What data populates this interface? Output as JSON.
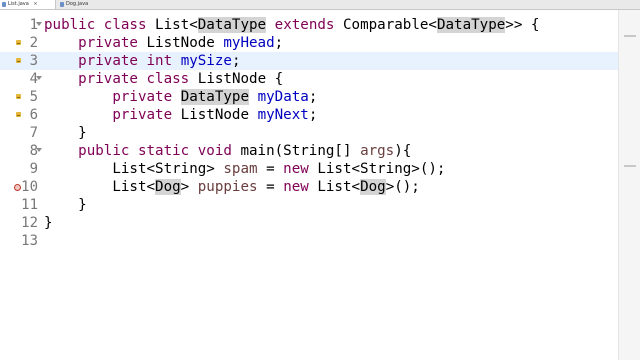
{
  "tabs": [
    {
      "label": "List.java",
      "close": "⨯",
      "active": true
    },
    {
      "label": "Dog.java",
      "close": "",
      "active": false
    }
  ],
  "editor": {
    "lines": [
      {
        "number": "1",
        "marker": "",
        "collapse": true,
        "segments": [
          {
            "t": "public",
            "c": "kw"
          },
          {
            "t": " ",
            "c": ""
          },
          {
            "t": "class",
            "c": "kw"
          },
          {
            "t": " List<",
            "c": ""
          },
          {
            "t": "DataType",
            "c": "hl"
          },
          {
            "t": " ",
            "c": ""
          },
          {
            "t": "extends",
            "c": "kw"
          },
          {
            "t": " Comparable<",
            "c": ""
          },
          {
            "t": "DataType",
            "c": "hl"
          },
          {
            "t": ">> {",
            "c": ""
          }
        ]
      },
      {
        "number": "2",
        "marker": "warning",
        "collapse": false,
        "segments": [
          {
            "t": "    ",
            "c": ""
          },
          {
            "t": "private",
            "c": "kw"
          },
          {
            "t": " ListNode ",
            "c": ""
          },
          {
            "t": "myHead",
            "c": "fld"
          },
          {
            "t": ";",
            "c": ""
          }
        ]
      },
      {
        "number": "3",
        "marker": "warning",
        "collapse": false,
        "current": true,
        "segments": [
          {
            "t": "    ",
            "c": ""
          },
          {
            "t": "private",
            "c": "kw"
          },
          {
            "t": " ",
            "c": ""
          },
          {
            "t": "int",
            "c": "kw"
          },
          {
            "t": " ",
            "c": ""
          },
          {
            "t": "mySize",
            "c": "fld"
          },
          {
            "t": ";",
            "c": ""
          }
        ]
      },
      {
        "number": "4",
        "marker": "",
        "collapse": true,
        "segments": [
          {
            "t": "    ",
            "c": ""
          },
          {
            "t": "private",
            "c": "kw"
          },
          {
            "t": " ",
            "c": ""
          },
          {
            "t": "class",
            "c": "kw"
          },
          {
            "t": " ListNode {",
            "c": ""
          }
        ]
      },
      {
        "number": "5",
        "marker": "warning",
        "collapse": false,
        "segments": [
          {
            "t": "        ",
            "c": ""
          },
          {
            "t": "private",
            "c": "kw"
          },
          {
            "t": " ",
            "c": ""
          },
          {
            "t": "DataType",
            "c": "hl"
          },
          {
            "t": " ",
            "c": ""
          },
          {
            "t": "myData",
            "c": "fld"
          },
          {
            "t": ";",
            "c": ""
          }
        ]
      },
      {
        "number": "6",
        "marker": "warning",
        "collapse": false,
        "segments": [
          {
            "t": "        ",
            "c": ""
          },
          {
            "t": "private",
            "c": "kw"
          },
          {
            "t": " ListNode ",
            "c": ""
          },
          {
            "t": "myNext",
            "c": "fld"
          },
          {
            "t": ";",
            "c": ""
          }
        ]
      },
      {
        "number": "7",
        "marker": "",
        "collapse": false,
        "segments": [
          {
            "t": "    }",
            "c": ""
          }
        ]
      },
      {
        "number": "8",
        "marker": "",
        "collapse": true,
        "segments": [
          {
            "t": "    ",
            "c": ""
          },
          {
            "t": "public",
            "c": "kw"
          },
          {
            "t": " ",
            "c": ""
          },
          {
            "t": "static",
            "c": "kw"
          },
          {
            "t": " ",
            "c": ""
          },
          {
            "t": "void",
            "c": "kw"
          },
          {
            "t": " main(String[] ",
            "c": ""
          },
          {
            "t": "args",
            "c": "var"
          },
          {
            "t": "){",
            "c": ""
          }
        ]
      },
      {
        "number": "9",
        "marker": "",
        "collapse": false,
        "segments": [
          {
            "t": "        List<String> ",
            "c": ""
          },
          {
            "t": "spam",
            "c": "var"
          },
          {
            "t": " = ",
            "c": ""
          },
          {
            "t": "new",
            "c": "kw"
          },
          {
            "t": " List<String>();",
            "c": ""
          }
        ]
      },
      {
        "number": "10",
        "marker": "error",
        "collapse": false,
        "segments": [
          {
            "t": "        List<",
            "c": ""
          },
          {
            "t": "Dog",
            "c": "hl"
          },
          {
            "t": "> ",
            "c": ""
          },
          {
            "t": "puppies",
            "c": "var"
          },
          {
            "t": " = ",
            "c": ""
          },
          {
            "t": "new",
            "c": "kw"
          },
          {
            "t": " List<",
            "c": ""
          },
          {
            "t": "Dog",
            "c": "hl"
          },
          {
            "t": ">();",
            "c": ""
          }
        ]
      },
      {
        "number": "11",
        "marker": "",
        "collapse": false,
        "segments": [
          {
            "t": "    }",
            "c": ""
          }
        ]
      },
      {
        "number": "12",
        "marker": "",
        "collapse": false,
        "segments": [
          {
            "t": "}",
            "c": ""
          }
        ]
      },
      {
        "number": "13",
        "marker": "",
        "collapse": false,
        "segments": []
      }
    ]
  },
  "colors": {
    "keyword": "#7f0055",
    "field": "#0000c0",
    "local_variable": "#6a3e3e",
    "current_line": "#e8f2fe",
    "occurrence_highlight": "#d4d4d4",
    "line_number": "#787878"
  },
  "icons": {
    "warning": "warning-icon",
    "error": "error-icon",
    "collapse": "collapse-arrow-icon",
    "file": "java-file-icon"
  }
}
